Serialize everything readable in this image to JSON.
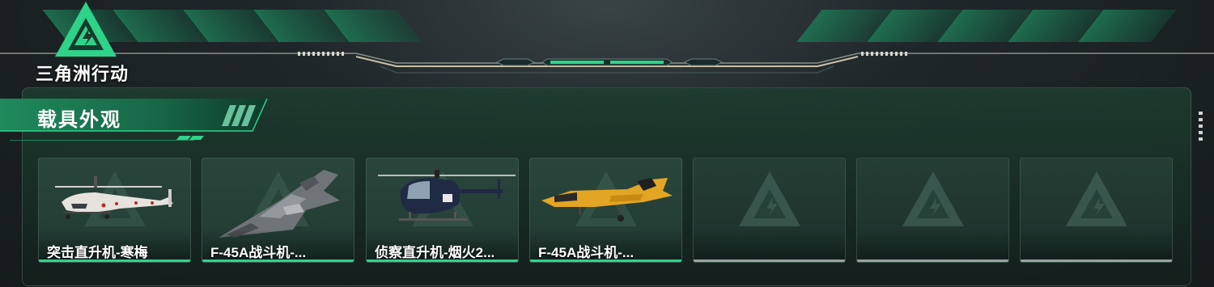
{
  "header": {
    "logo_text": "三角洲行动"
  },
  "section": {
    "title": "载具外观"
  },
  "colors": {
    "accent": "#2ed38a",
    "empty_bar": "#9aa3a0"
  },
  "cards": [
    {
      "name": "突击直升机-寒梅",
      "vehicle_icon": "attack-helicopter-icon"
    },
    {
      "name": "F-45A战斗机-...",
      "vehicle_icon": "fighter-jet-icon"
    },
    {
      "name": "侦察直升机-烟火2...",
      "vehicle_icon": "scout-helicopter-icon"
    },
    {
      "name": "F-45A战斗机-...",
      "vehicle_icon": "yellow-fighter-jet-icon"
    },
    {
      "name": "",
      "vehicle_icon": "empty-slot-icon"
    },
    {
      "name": "",
      "vehicle_icon": "empty-slot-icon"
    },
    {
      "name": "",
      "vehicle_icon": "empty-slot-icon"
    }
  ]
}
